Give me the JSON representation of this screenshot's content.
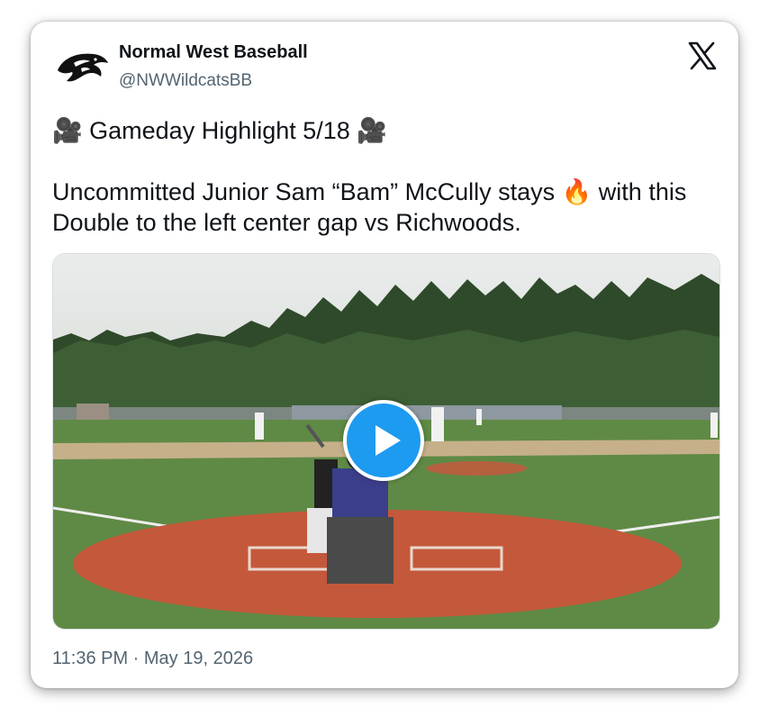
{
  "account": {
    "display_name": "Normal West Baseball",
    "handle": "@NWWildcatsBB",
    "avatar_icon": "wildcat-logo-icon"
  },
  "platform_icon": "x-logo-icon",
  "post": {
    "line1_emoji_left": "🎥",
    "line1_text": "Gameday Highlight 5/18",
    "line1_emoji_right": "🎥",
    "line2_before": "Uncommitted Junior Sam “Bam” McCully stays",
    "line2_emoji": "🔥",
    "line2_after": "with this Double to the left center gap vs Richwoods."
  },
  "media": {
    "type": "video",
    "play_icon": "play-icon",
    "scene": "baseball-batter-at-home-plate"
  },
  "timestamp": "11:36 PM · May 19, 2026",
  "colors": {
    "accent": "#1d9bf0",
    "text": "#0f1419",
    "muted": "#536471"
  }
}
